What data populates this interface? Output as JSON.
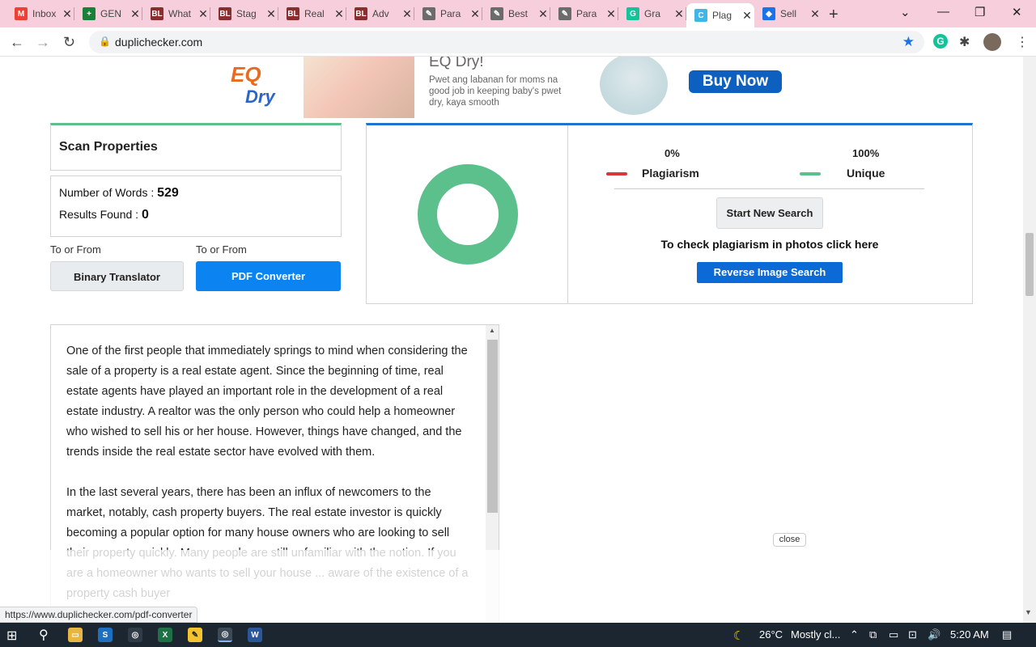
{
  "browser": {
    "tabs": [
      {
        "title": "Inbox",
        "favicon": "M",
        "favicon_color": "#ea4335"
      },
      {
        "title": "GEN",
        "favicon": "+",
        "favicon_color": "#188038"
      },
      {
        "title": "What",
        "favicon": "BL",
        "favicon_color": "#8a2d2d"
      },
      {
        "title": "Stag",
        "favicon": "BL",
        "favicon_color": "#8a2d2d"
      },
      {
        "title": "Real",
        "favicon": "BL",
        "favicon_color": "#8a2d2d"
      },
      {
        "title": "Adv",
        "favicon": "BL",
        "favicon_color": "#8a2d2d"
      },
      {
        "title": "Para",
        "favicon": "✎",
        "favicon_color": "#6b6b6b"
      },
      {
        "title": "Best",
        "favicon": "✎",
        "favicon_color": "#6b6b6b"
      },
      {
        "title": "Para",
        "favicon": "✎",
        "favicon_color": "#6b6b6b"
      },
      {
        "title": "Gra",
        "favicon": "G",
        "favicon_color": "#15c39a"
      },
      {
        "title": "Plag",
        "favicon": "C",
        "favicon_color": "#3fb6e8",
        "active": true
      },
      {
        "title": "Sell",
        "favicon": "◆",
        "favicon_color": "#1a73e8"
      }
    ],
    "url": "duplichecker.com"
  },
  "ad": {
    "brand": "EQ",
    "brand_sub": "Dry",
    "title": "EQ Dry!",
    "text": "Pwet ang labanan for moms na good job in keeping baby's pwet dry, kaya smooth",
    "cta": "Buy Now"
  },
  "scan": {
    "title": "Scan Properties",
    "words_label": "Number of Words : ",
    "words_value": "529",
    "results_label": "Results Found : ",
    "results_value": "0"
  },
  "links": {
    "binary_label": "To or From",
    "binary_button": "Binary Translator",
    "pdf_label": "To or From",
    "pdf_button": "PDF Converter"
  },
  "results": {
    "plagiarism_pct": "0%",
    "plagiarism_label": "Plagiarism",
    "unique_pct": "100%",
    "unique_label": "Unique",
    "new_search": "Start New Search",
    "photo_text": "To check plagiarism in photos click here",
    "reverse_image": "Reverse Image Search",
    "plagiarism_fraction": 0,
    "unique_color": "#5cc08c",
    "plagiarism_color": "#d93737"
  },
  "content": {
    "p1": "One of the first people that immediately springs to mind when considering the sale of a property is a real estate agent. Since the beginning of time, real estate agents have played an important role in the development of a real estate industry. A realtor was the only person who could help a homeowner who wished to sell his or her house. However, things have changed, and the trends inside the real estate sector have evolved with them.",
    "p2": "In the last several years, there has been an influx of newcomers to the market, notably, cash property buyers. The real estate investor is quickly becoming a popular option for many house owners who are looking to sell their property quickly. Many people are still unfamiliar with the notion. If you are a homeowner who wants to sell your house ... aware of the existence of a property cash buyer"
  },
  "overlay": {
    "close": "close",
    "status_url": "https://www.duplichecker.com/pdf-converter"
  },
  "taskbar": {
    "temp": "26°C",
    "weather": "Mostly cl...",
    "time": "5:20 AM"
  }
}
